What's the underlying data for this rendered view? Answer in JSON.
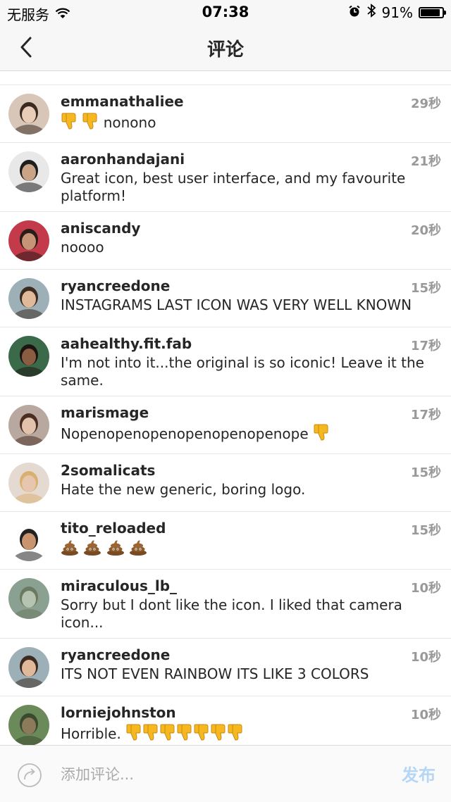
{
  "status_bar": {
    "carrier": "无服务",
    "time": "07:38",
    "battery": "91%",
    "battery_level": 0.91
  },
  "nav": {
    "title": "评论"
  },
  "comments": [
    {
      "username": "emmanathaliee",
      "text": "nonono",
      "emoji_before": [
        "thumbs-down",
        "thumbs-down"
      ],
      "emoji_after": [],
      "time": "29秒"
    },
    {
      "username": "aaronhandajani",
      "text": "Great icon, best user interface, and my favourite platform!",
      "emoji_before": [],
      "emoji_after": [],
      "time": "21秒"
    },
    {
      "username": "aniscandy",
      "text": "noooo",
      "emoji_before": [],
      "emoji_after": [],
      "time": "20秒"
    },
    {
      "username": "ryancreedone",
      "text": "INSTAGRAMS LAST ICON WAS VERY WELL KNOWN",
      "emoji_before": [],
      "emoji_after": [],
      "time": "15秒"
    },
    {
      "username": "aahealthy.fit.fab",
      "text": "I'm not into it...the original is so iconic! Leave it the same.",
      "emoji_before": [],
      "emoji_after": [],
      "time": "17秒"
    },
    {
      "username": "marismage",
      "text": "Nopenopenopenopenopenopenope",
      "emoji_before": [],
      "emoji_after": [
        "thumbs-down"
      ],
      "time": "17秒"
    },
    {
      "username": "2somalicats",
      "text": "Hate the new generic, boring logo.",
      "emoji_before": [],
      "emoji_after": [],
      "time": "15秒"
    },
    {
      "username": "tito_reloaded",
      "text": "",
      "emoji_before": [
        "poop",
        "poop",
        "poop",
        "poop"
      ],
      "emoji_after": [],
      "time": "15秒"
    },
    {
      "username": "miraculous_lb_",
      "text": "Sorry but I dont like the icon. I liked that camera icon...",
      "emoji_before": [],
      "emoji_after": [],
      "time": "10秒"
    },
    {
      "username": "ryancreedone",
      "text": "ITS NOT EVEN RAINBOW ITS LIKE 3 COLORS",
      "emoji_before": [],
      "emoji_after": [],
      "time": "10秒"
    },
    {
      "username": "lorniejohnston",
      "text": "Horrible.",
      "emoji_before": [],
      "emoji_after": [
        "thumbs-down",
        "thumbs-down",
        "thumbs-down",
        "thumbs-down",
        "thumbs-down",
        "thumbs-down",
        "thumbs-down"
      ],
      "time": "10秒"
    }
  ],
  "input_bar": {
    "placeholder": "添加评论...",
    "post_label": "发布"
  },
  "colors": {
    "accent_disabled": "#b5d6f5",
    "text": "#262626",
    "muted": "#999999",
    "emoji_yellow": "#f5b820",
    "poop_brown": "#8b5a2b"
  }
}
